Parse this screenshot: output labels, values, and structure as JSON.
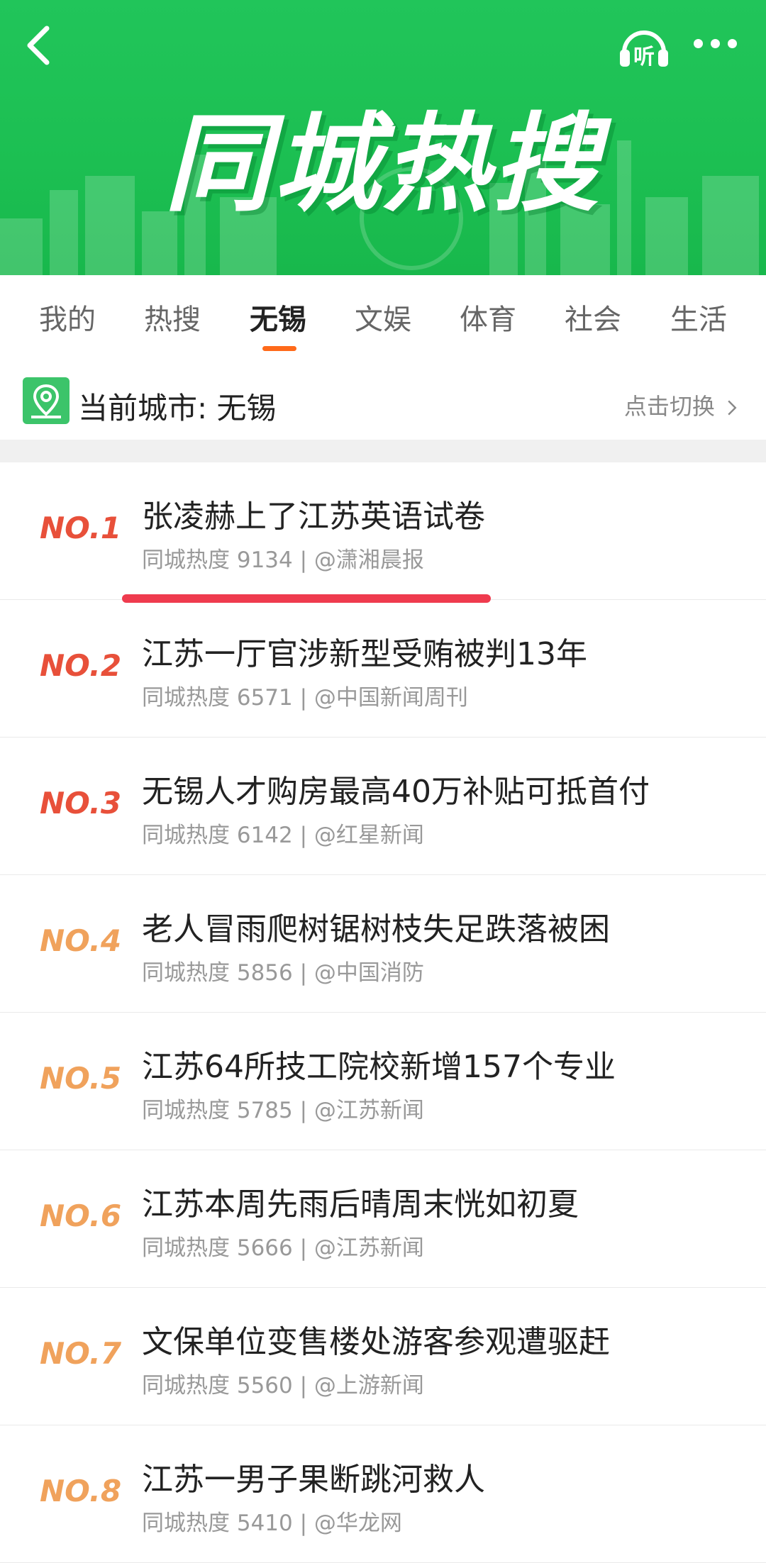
{
  "header": {
    "title": "同城热搜",
    "listen_label": "听"
  },
  "tabs": [
    {
      "label": "我的",
      "active": false
    },
    {
      "label": "热搜",
      "active": false
    },
    {
      "label": "无锡",
      "active": true
    },
    {
      "label": "文娱",
      "active": false
    },
    {
      "label": "体育",
      "active": false
    },
    {
      "label": "社会",
      "active": false
    },
    {
      "label": "生活",
      "active": false
    }
  ],
  "city": {
    "label": "当前城市: 无锡",
    "switch_label": "点击切换"
  },
  "list": [
    {
      "rank": "NO.1",
      "title": "张凌赫上了江苏英语试卷",
      "meta": "同城热度 9134 | @潇湘晨报",
      "color": "#e8503a"
    },
    {
      "rank": "NO.2",
      "title": "江苏一厅官涉新型受贿被判13年",
      "meta": "同城热度 6571 | @中国新闻周刊",
      "color": "#e8503a"
    },
    {
      "rank": "NO.3",
      "title": "无锡人才购房最高40万补贴可抵首付",
      "meta": "同城热度 6142 | @红星新闻",
      "color": "#e8503a"
    },
    {
      "rank": "NO.4",
      "title": "老人冒雨爬树锯树枝失足跌落被困",
      "meta": "同城热度 5856 | @中国消防",
      "color": "#f0a25c"
    },
    {
      "rank": "NO.5",
      "title": "江苏64所技工院校新增157个专业",
      "meta": "同城热度 5785 | @江苏新闻",
      "color": "#f0a25c"
    },
    {
      "rank": "NO.6",
      "title": "江苏本周先雨后晴周末恍如初夏",
      "meta": "同城热度 5666 | @江苏新闻",
      "color": "#f0a25c"
    },
    {
      "rank": "NO.7",
      "title": "文保单位变售楼处游客参观遭驱赶",
      "meta": "同城热度 5560 | @上游新闻",
      "color": "#f0a25c"
    },
    {
      "rank": "NO.8",
      "title": "江苏一男子果断跳河救人",
      "meta": "同城热度 5410 | @华龙网",
      "color": "#f0a25c"
    }
  ]
}
